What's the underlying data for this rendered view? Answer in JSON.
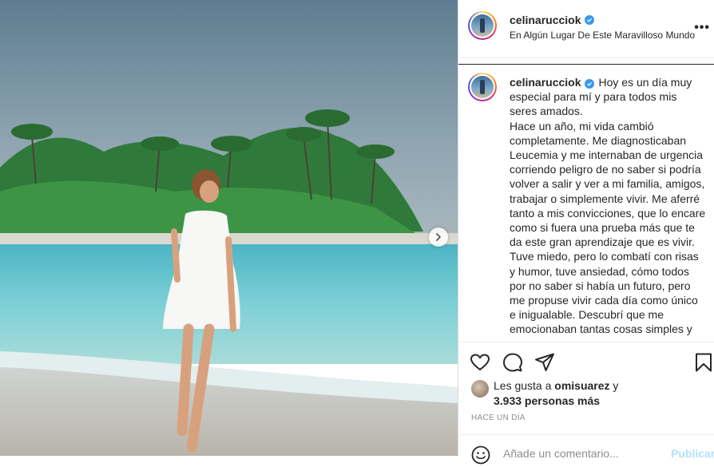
{
  "post": {
    "username": "celinarucciok",
    "location": "En Algún Lugar De Este Maravilloso Mundo",
    "caption": "Hoy es un día muy especial para mí y para todos mis seres amados.\nHace un año, mi vida cambió completamente. Me diagnosticaban Leucemia y me internaban de urgencia corriendo peligro de no saber si podría volver a salir y ver a mi familia, amigos, trabajar o simplemente vivir. Me aferré tanto a mis convicciones, que lo encare como si fuera una prueba más que te da este gran aprendizaje que es vivir. Tuve miedo, pero lo combatí con risas y humor, tuve ansiedad, cómo todos por no saber si había un futuro, pero me propuse vivir cada día como único e inigualable. Descubrí que me emocionaban tantas cosas simples y",
    "likes_prefix": "Les gusta a ",
    "likes_user": "omisuarez",
    "likes_suffix": " y",
    "likes_others": "3.933 personas más",
    "time": "HACE UN DÍA"
  },
  "comment_box": {
    "placeholder": "Añade un comentario...",
    "post_label": "Publicar"
  },
  "icons": {
    "verified": "verified-badge-icon",
    "more": "more-options-icon",
    "like": "heart-icon",
    "comment": "comment-icon",
    "share": "paper-plane-icon",
    "save": "bookmark-icon",
    "emoji": "emoji-icon",
    "next": "chevron-right-icon"
  },
  "colors": {
    "verified": "#3897f0",
    "post_button": "#b2dffc",
    "muted_text": "#8e8e8e"
  }
}
